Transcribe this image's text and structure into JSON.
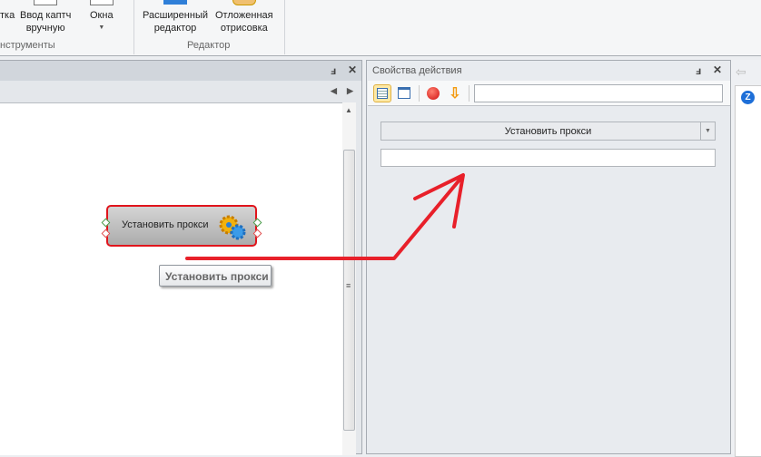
{
  "ribbon": {
    "buttons": [
      {
        "label": "тка"
      },
      {
        "label": "Ввод каптч вручную",
        "line1": "Ввод каптч",
        "line2": "вручную"
      },
      {
        "label": "Окна"
      },
      {
        "label": "Расширенный редактор",
        "line1": "Расширенный",
        "line2": "редактор"
      },
      {
        "label": "Отложенная отрисовка",
        "line1": "Отложенная",
        "line2": "отрисовка"
      }
    ],
    "groups": [
      "нструменты",
      "Редактор"
    ]
  },
  "left_panel": {
    "node_label": "Установить прокси",
    "tooltip": "Установить прокси"
  },
  "right_panel": {
    "title": "Свойства действия",
    "search_value": "",
    "action_select": "Установить прокси",
    "field_value": ""
  },
  "colors": {
    "arrow": "#e8202a",
    "node_border": "#e0141c"
  }
}
